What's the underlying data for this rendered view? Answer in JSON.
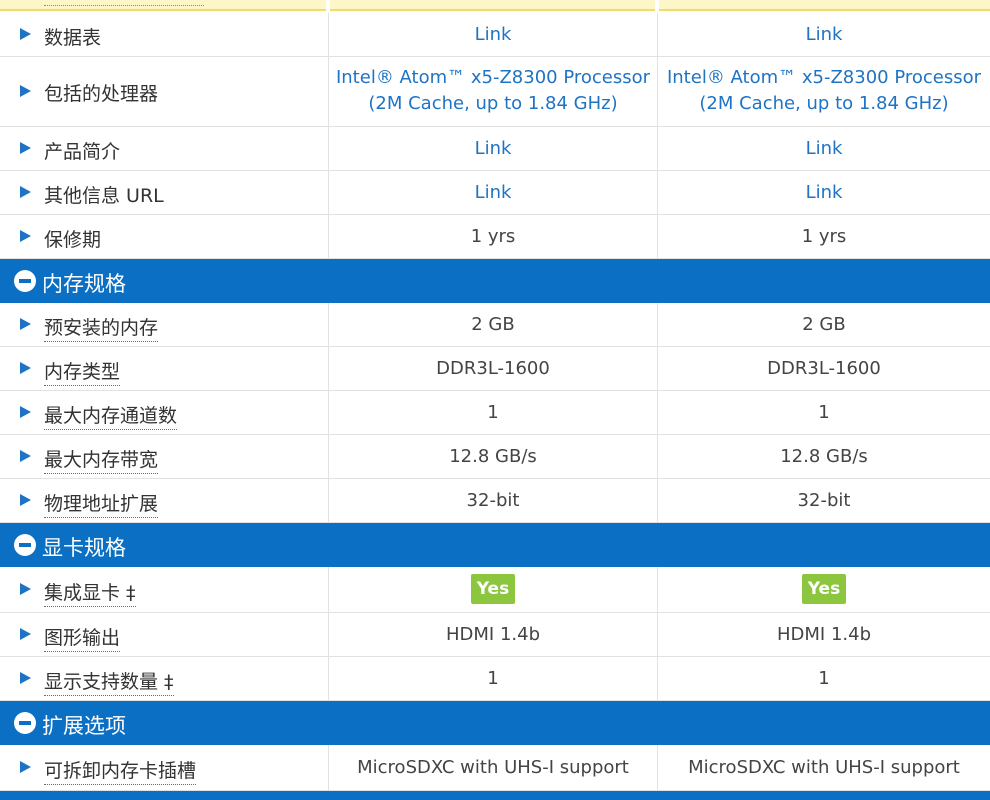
{
  "spec_rows_group1": [
    {
      "label": "数据表",
      "col1": "Link",
      "col2": "Link"
    },
    {
      "label": "包括的处理器",
      "col1_line1": "Intel® Atom™ x5-Z8300 Processor",
      "col1_line2": "(2M Cache, up to 1.84 GHz)",
      "col2_line1": "Intel® Atom™ x5-Z8300 Processor",
      "col2_line2": "(2M Cache, up to 1.84 GHz)"
    },
    {
      "label": "产品简介",
      "col1": "Link",
      "col2": "Link"
    },
    {
      "label": "其他信息 URL",
      "col1": "Link",
      "col2": "Link"
    },
    {
      "label": "保修期",
      "col1": "1 yrs",
      "col2": "1 yrs"
    }
  ],
  "sections": {
    "memory": {
      "title": "内存规格",
      "rows": [
        {
          "label": "预安装的内存",
          "col1": "2 GB",
          "col2": "2 GB"
        },
        {
          "label": "内存类型",
          "col1": "DDR3L-1600",
          "col2": "DDR3L-1600"
        },
        {
          "label": "最大内存通道数",
          "col1": "1",
          "col2": "1"
        },
        {
          "label": "最大内存带宽",
          "col1": "12.8 GB/s",
          "col2": "12.8 GB/s"
        },
        {
          "label": "物理地址扩展",
          "col1": "32-bit",
          "col2": "32-bit"
        }
      ]
    },
    "graphics": {
      "title": "显卡规格",
      "rows": [
        {
          "label": "集成显卡 ‡",
          "col1": "Yes",
          "col2": "Yes"
        },
        {
          "label": "图形输出",
          "col1": "HDMI 1.4b",
          "col2": "HDMI 1.4b"
        },
        {
          "label": "显示支持数量 ‡",
          "col1": "1",
          "col2": "1"
        }
      ]
    },
    "expansion": {
      "title": "扩展选项",
      "rows": [
        {
          "label": "可拆卸内存卡插槽",
          "col1": "MicroSDXC with UHS-I support",
          "col2": "MicroSDXC with UHS-I support"
        }
      ]
    }
  },
  "colors": {
    "section_header": "#0b6fc4",
    "arrow": "#1f73c4",
    "link": "#1f73c4",
    "yes_badge": "#8cc63f",
    "highlight_row": "#fdf6c9"
  },
  "icons": {
    "row_expand": "triangle-right-icon",
    "section_collapse": "minus-circle-icon"
  }
}
